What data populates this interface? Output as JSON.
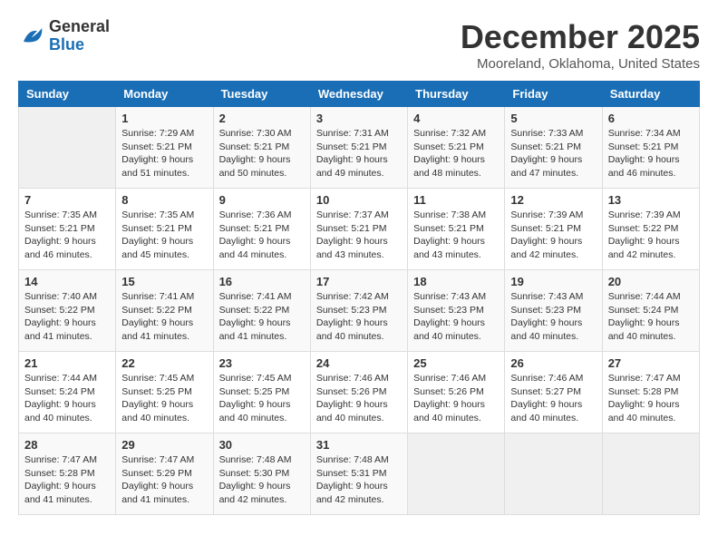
{
  "logo": {
    "line1": "General",
    "line2": "Blue"
  },
  "title": "December 2025",
  "subtitle": "Mooreland, Oklahoma, United States",
  "days_header": [
    "Sunday",
    "Monday",
    "Tuesday",
    "Wednesday",
    "Thursday",
    "Friday",
    "Saturday"
  ],
  "weeks": [
    [
      {
        "num": "",
        "info": ""
      },
      {
        "num": "1",
        "info": "Sunrise: 7:29 AM\nSunset: 5:21 PM\nDaylight: 9 hours\nand 51 minutes."
      },
      {
        "num": "2",
        "info": "Sunrise: 7:30 AM\nSunset: 5:21 PM\nDaylight: 9 hours\nand 50 minutes."
      },
      {
        "num": "3",
        "info": "Sunrise: 7:31 AM\nSunset: 5:21 PM\nDaylight: 9 hours\nand 49 minutes."
      },
      {
        "num": "4",
        "info": "Sunrise: 7:32 AM\nSunset: 5:21 PM\nDaylight: 9 hours\nand 48 minutes."
      },
      {
        "num": "5",
        "info": "Sunrise: 7:33 AM\nSunset: 5:21 PM\nDaylight: 9 hours\nand 47 minutes."
      },
      {
        "num": "6",
        "info": "Sunrise: 7:34 AM\nSunset: 5:21 PM\nDaylight: 9 hours\nand 46 minutes."
      }
    ],
    [
      {
        "num": "7",
        "info": "Sunrise: 7:35 AM\nSunset: 5:21 PM\nDaylight: 9 hours\nand 46 minutes."
      },
      {
        "num": "8",
        "info": "Sunrise: 7:35 AM\nSunset: 5:21 PM\nDaylight: 9 hours\nand 45 minutes."
      },
      {
        "num": "9",
        "info": "Sunrise: 7:36 AM\nSunset: 5:21 PM\nDaylight: 9 hours\nand 44 minutes."
      },
      {
        "num": "10",
        "info": "Sunrise: 7:37 AM\nSunset: 5:21 PM\nDaylight: 9 hours\nand 43 minutes."
      },
      {
        "num": "11",
        "info": "Sunrise: 7:38 AM\nSunset: 5:21 PM\nDaylight: 9 hours\nand 43 minutes."
      },
      {
        "num": "12",
        "info": "Sunrise: 7:39 AM\nSunset: 5:21 PM\nDaylight: 9 hours\nand 42 minutes."
      },
      {
        "num": "13",
        "info": "Sunrise: 7:39 AM\nSunset: 5:22 PM\nDaylight: 9 hours\nand 42 minutes."
      }
    ],
    [
      {
        "num": "14",
        "info": "Sunrise: 7:40 AM\nSunset: 5:22 PM\nDaylight: 9 hours\nand 41 minutes."
      },
      {
        "num": "15",
        "info": "Sunrise: 7:41 AM\nSunset: 5:22 PM\nDaylight: 9 hours\nand 41 minutes."
      },
      {
        "num": "16",
        "info": "Sunrise: 7:41 AM\nSunset: 5:22 PM\nDaylight: 9 hours\nand 41 minutes."
      },
      {
        "num": "17",
        "info": "Sunrise: 7:42 AM\nSunset: 5:23 PM\nDaylight: 9 hours\nand 40 minutes."
      },
      {
        "num": "18",
        "info": "Sunrise: 7:43 AM\nSunset: 5:23 PM\nDaylight: 9 hours\nand 40 minutes."
      },
      {
        "num": "19",
        "info": "Sunrise: 7:43 AM\nSunset: 5:23 PM\nDaylight: 9 hours\nand 40 minutes."
      },
      {
        "num": "20",
        "info": "Sunrise: 7:44 AM\nSunset: 5:24 PM\nDaylight: 9 hours\nand 40 minutes."
      }
    ],
    [
      {
        "num": "21",
        "info": "Sunrise: 7:44 AM\nSunset: 5:24 PM\nDaylight: 9 hours\nand 40 minutes."
      },
      {
        "num": "22",
        "info": "Sunrise: 7:45 AM\nSunset: 5:25 PM\nDaylight: 9 hours\nand 40 minutes."
      },
      {
        "num": "23",
        "info": "Sunrise: 7:45 AM\nSunset: 5:25 PM\nDaylight: 9 hours\nand 40 minutes."
      },
      {
        "num": "24",
        "info": "Sunrise: 7:46 AM\nSunset: 5:26 PM\nDaylight: 9 hours\nand 40 minutes."
      },
      {
        "num": "25",
        "info": "Sunrise: 7:46 AM\nSunset: 5:26 PM\nDaylight: 9 hours\nand 40 minutes."
      },
      {
        "num": "26",
        "info": "Sunrise: 7:46 AM\nSunset: 5:27 PM\nDaylight: 9 hours\nand 40 minutes."
      },
      {
        "num": "27",
        "info": "Sunrise: 7:47 AM\nSunset: 5:28 PM\nDaylight: 9 hours\nand 40 minutes."
      }
    ],
    [
      {
        "num": "28",
        "info": "Sunrise: 7:47 AM\nSunset: 5:28 PM\nDaylight: 9 hours\nand 41 minutes."
      },
      {
        "num": "29",
        "info": "Sunrise: 7:47 AM\nSunset: 5:29 PM\nDaylight: 9 hours\nand 41 minutes."
      },
      {
        "num": "30",
        "info": "Sunrise: 7:48 AM\nSunset: 5:30 PM\nDaylight: 9 hours\nand 42 minutes."
      },
      {
        "num": "31",
        "info": "Sunrise: 7:48 AM\nSunset: 5:31 PM\nDaylight: 9 hours\nand 42 minutes."
      },
      {
        "num": "",
        "info": ""
      },
      {
        "num": "",
        "info": ""
      },
      {
        "num": "",
        "info": ""
      }
    ]
  ]
}
